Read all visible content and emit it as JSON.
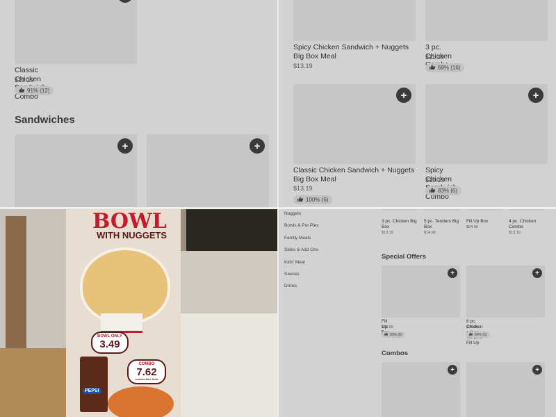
{
  "colors": {
    "add_button": "#3a3a3a",
    "card_placeholder": "#c6c6c6",
    "banner_red": "#c31b2b"
  },
  "icons": {
    "add": "plus-icon",
    "rating": "thumbs-up-icon"
  },
  "top_left": {
    "card1": {
      "name": "Classic Chicken Sandwich Combo",
      "price": "$10.19",
      "rating": "91% (12)"
    },
    "section_title": "Sandwiches",
    "add_label": "+"
  },
  "top_right": {
    "card1": {
      "name": "Spicy Chicken Sandwich + Nuggets Big Box Meal",
      "price": "$13.19"
    },
    "card2": {
      "name": "3 pc. Chicken Combo",
      "price": "$11.39",
      "rating": "68% (16)"
    },
    "card3": {
      "name": "Classic Chicken Sandwich + Nuggets Big Box Meal",
      "price": "$13.19",
      "rating": "100% (6)"
    },
    "card4": {
      "name": "Spicy Chicken Sandwich Combo",
      "price": "$10.19",
      "rating": "83% (6)"
    },
    "add_label": "+"
  },
  "photo": {
    "title": "BOWL",
    "subtitle": "WITH NUGGETS",
    "tag1_label": "BOWL ONLY",
    "tag1_value": "3.49",
    "tag2_label": "COMBO",
    "tag2_value": "7.62",
    "tag2_note": "Includes Med. Drink",
    "pepsi": "PEPSI"
  },
  "bottom_right": {
    "sidebar": [
      "Nuggets",
      "Bowls & Pot Pies",
      "Family Meals",
      "Sides & Add Ons",
      "Kids' Meal",
      "Sauces",
      "Drinks"
    ],
    "top_row": [
      {
        "name": "3 pc. Chicken Big Box",
        "price": "$13.19"
      },
      {
        "name": "5 pc. Tenders Big Box",
        "price": "$14.99"
      },
      {
        "name": "Fill Up Box",
        "price": "$24.00"
      },
      {
        "name": "4 pc. Chicken Combo",
        "price": "$13.19"
      }
    ],
    "special_title": "Special Offers",
    "special": [
      {
        "name": "Fill Up Box",
        "price": "$24.00",
        "rating": "83% (6)"
      },
      {
        "name": "8 pc. Chicken + 8 pc. Tenders Fill Up",
        "price": "$36.00",
        "rating": "80% (5)"
      }
    ],
    "combos_title": "Combos",
    "add_label": "+"
  }
}
